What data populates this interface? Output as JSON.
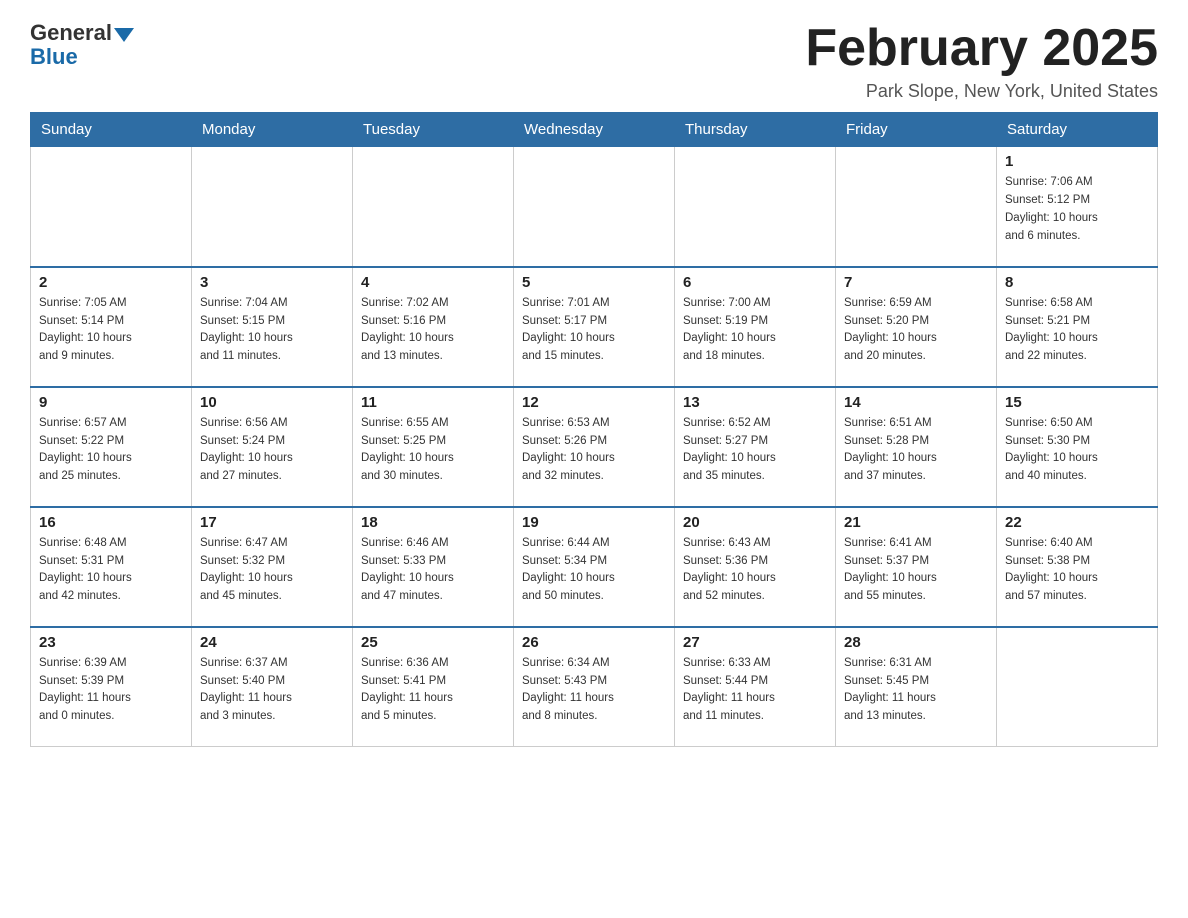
{
  "header": {
    "logo_general": "General",
    "logo_blue": "Blue",
    "title": "February 2025",
    "location": "Park Slope, New York, United States"
  },
  "weekdays": [
    "Sunday",
    "Monday",
    "Tuesday",
    "Wednesday",
    "Thursday",
    "Friday",
    "Saturday"
  ],
  "weeks": [
    [
      {
        "day": "",
        "info": ""
      },
      {
        "day": "",
        "info": ""
      },
      {
        "day": "",
        "info": ""
      },
      {
        "day": "",
        "info": ""
      },
      {
        "day": "",
        "info": ""
      },
      {
        "day": "",
        "info": ""
      },
      {
        "day": "1",
        "info": "Sunrise: 7:06 AM\nSunset: 5:12 PM\nDaylight: 10 hours\nand 6 minutes."
      }
    ],
    [
      {
        "day": "2",
        "info": "Sunrise: 7:05 AM\nSunset: 5:14 PM\nDaylight: 10 hours\nand 9 minutes."
      },
      {
        "day": "3",
        "info": "Sunrise: 7:04 AM\nSunset: 5:15 PM\nDaylight: 10 hours\nand 11 minutes."
      },
      {
        "day": "4",
        "info": "Sunrise: 7:02 AM\nSunset: 5:16 PM\nDaylight: 10 hours\nand 13 minutes."
      },
      {
        "day": "5",
        "info": "Sunrise: 7:01 AM\nSunset: 5:17 PM\nDaylight: 10 hours\nand 15 minutes."
      },
      {
        "day": "6",
        "info": "Sunrise: 7:00 AM\nSunset: 5:19 PM\nDaylight: 10 hours\nand 18 minutes."
      },
      {
        "day": "7",
        "info": "Sunrise: 6:59 AM\nSunset: 5:20 PM\nDaylight: 10 hours\nand 20 minutes."
      },
      {
        "day": "8",
        "info": "Sunrise: 6:58 AM\nSunset: 5:21 PM\nDaylight: 10 hours\nand 22 minutes."
      }
    ],
    [
      {
        "day": "9",
        "info": "Sunrise: 6:57 AM\nSunset: 5:22 PM\nDaylight: 10 hours\nand 25 minutes."
      },
      {
        "day": "10",
        "info": "Sunrise: 6:56 AM\nSunset: 5:24 PM\nDaylight: 10 hours\nand 27 minutes."
      },
      {
        "day": "11",
        "info": "Sunrise: 6:55 AM\nSunset: 5:25 PM\nDaylight: 10 hours\nand 30 minutes."
      },
      {
        "day": "12",
        "info": "Sunrise: 6:53 AM\nSunset: 5:26 PM\nDaylight: 10 hours\nand 32 minutes."
      },
      {
        "day": "13",
        "info": "Sunrise: 6:52 AM\nSunset: 5:27 PM\nDaylight: 10 hours\nand 35 minutes."
      },
      {
        "day": "14",
        "info": "Sunrise: 6:51 AM\nSunset: 5:28 PM\nDaylight: 10 hours\nand 37 minutes."
      },
      {
        "day": "15",
        "info": "Sunrise: 6:50 AM\nSunset: 5:30 PM\nDaylight: 10 hours\nand 40 minutes."
      }
    ],
    [
      {
        "day": "16",
        "info": "Sunrise: 6:48 AM\nSunset: 5:31 PM\nDaylight: 10 hours\nand 42 minutes."
      },
      {
        "day": "17",
        "info": "Sunrise: 6:47 AM\nSunset: 5:32 PM\nDaylight: 10 hours\nand 45 minutes."
      },
      {
        "day": "18",
        "info": "Sunrise: 6:46 AM\nSunset: 5:33 PM\nDaylight: 10 hours\nand 47 minutes."
      },
      {
        "day": "19",
        "info": "Sunrise: 6:44 AM\nSunset: 5:34 PM\nDaylight: 10 hours\nand 50 minutes."
      },
      {
        "day": "20",
        "info": "Sunrise: 6:43 AM\nSunset: 5:36 PM\nDaylight: 10 hours\nand 52 minutes."
      },
      {
        "day": "21",
        "info": "Sunrise: 6:41 AM\nSunset: 5:37 PM\nDaylight: 10 hours\nand 55 minutes."
      },
      {
        "day": "22",
        "info": "Sunrise: 6:40 AM\nSunset: 5:38 PM\nDaylight: 10 hours\nand 57 minutes."
      }
    ],
    [
      {
        "day": "23",
        "info": "Sunrise: 6:39 AM\nSunset: 5:39 PM\nDaylight: 11 hours\nand 0 minutes."
      },
      {
        "day": "24",
        "info": "Sunrise: 6:37 AM\nSunset: 5:40 PM\nDaylight: 11 hours\nand 3 minutes."
      },
      {
        "day": "25",
        "info": "Sunrise: 6:36 AM\nSunset: 5:41 PM\nDaylight: 11 hours\nand 5 minutes."
      },
      {
        "day": "26",
        "info": "Sunrise: 6:34 AM\nSunset: 5:43 PM\nDaylight: 11 hours\nand 8 minutes."
      },
      {
        "day": "27",
        "info": "Sunrise: 6:33 AM\nSunset: 5:44 PM\nDaylight: 11 hours\nand 11 minutes."
      },
      {
        "day": "28",
        "info": "Sunrise: 6:31 AM\nSunset: 5:45 PM\nDaylight: 11 hours\nand 13 minutes."
      },
      {
        "day": "",
        "info": ""
      }
    ]
  ]
}
